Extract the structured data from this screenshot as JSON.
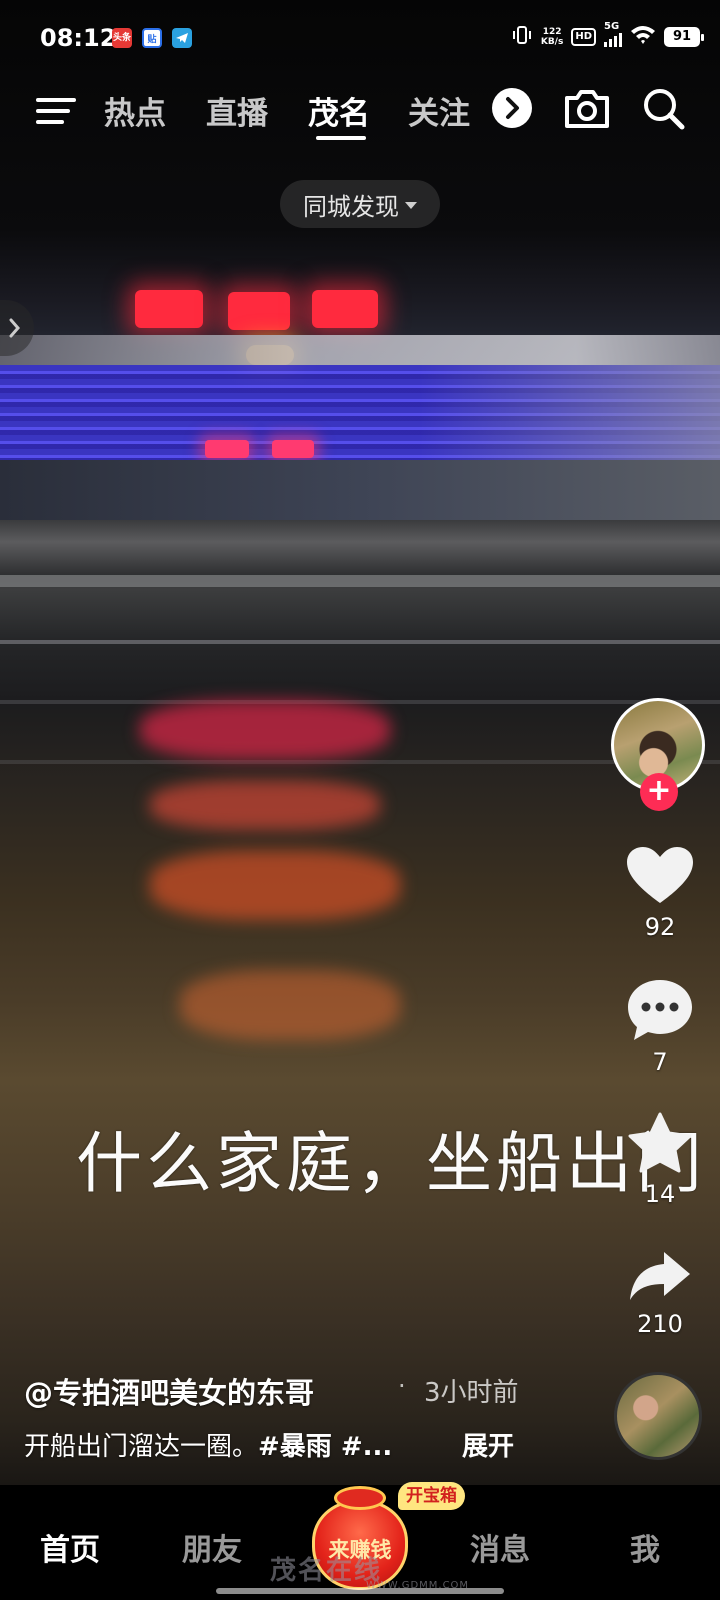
{
  "status_bar": {
    "time": "08:12",
    "notif_icons": [
      "toutiao-notification-icon",
      "tieba-notification-icon",
      "telegram-notification-icon"
    ],
    "notif_texts": [
      "头条",
      "贴",
      ""
    ],
    "net_speed_value": "122",
    "net_speed_unit": "KB/s",
    "hd_label": "HD",
    "network": "5G",
    "battery": "91"
  },
  "top_nav": {
    "tabs": [
      "热点",
      "直播",
      "茂名",
      "关注"
    ],
    "active_tab": "茂名"
  },
  "city_filter": {
    "label": "同城发现"
  },
  "video": {
    "overlay_text": "什么家庭，坐船出门",
    "colors": {
      "neon": "#ff2a3e",
      "building": "#3c36d0"
    }
  },
  "right_rail": {
    "likes": "92",
    "comments": "7",
    "favorites": "14",
    "shares": "210"
  },
  "post": {
    "author": "@专拍酒吧美女的东哥",
    "separator": "·",
    "time_ago": "3小时前",
    "description": "开船出门溜达一圈。",
    "hashtags": "#暴雨 #...",
    "expand_label": "展开"
  },
  "bottom_nav": {
    "tabs": [
      "首页",
      "朋友",
      "消息",
      "我"
    ],
    "active_tab": "首页",
    "earn_label": "来赚钱",
    "chest_label": "开宝箱"
  },
  "watermark": {
    "text": "茂名在线",
    "sub": "WWW.GDMM.COM"
  },
  "accent_color": "#fe2c55"
}
